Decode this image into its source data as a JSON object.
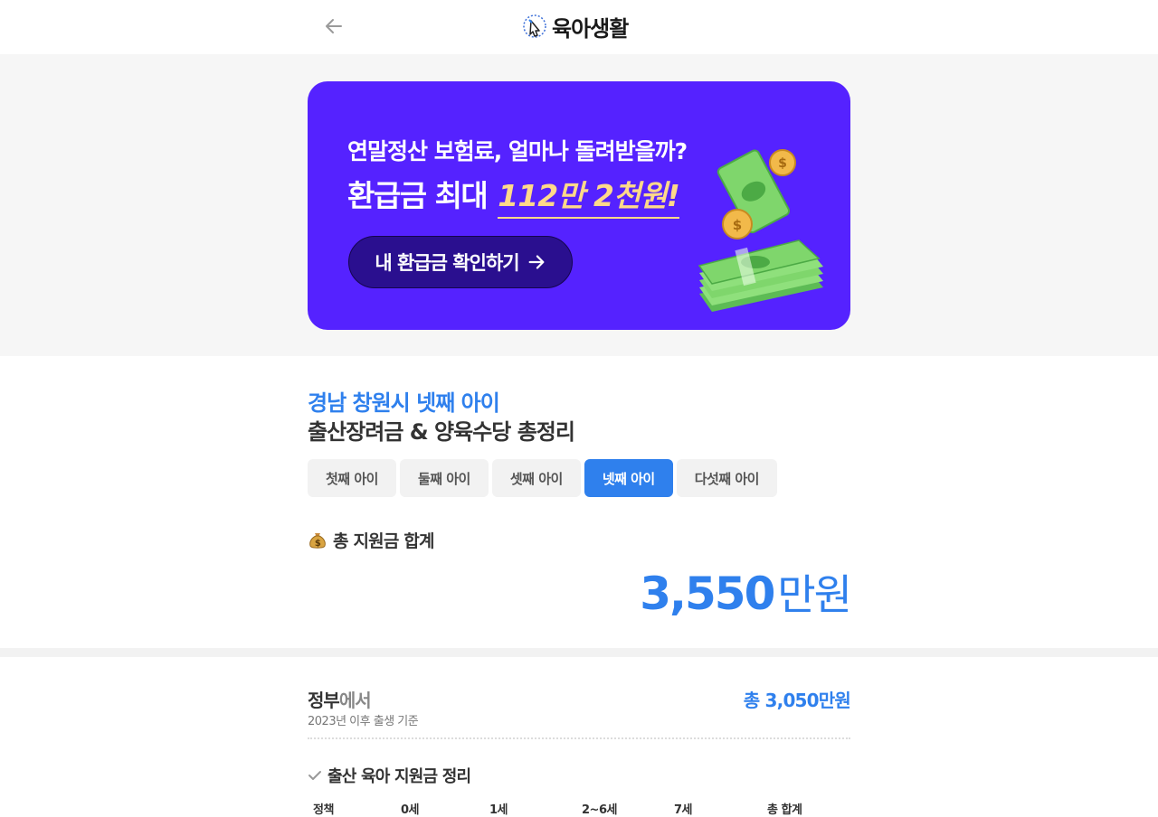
{
  "header": {
    "back_icon": "arrow-left-icon",
    "logo_icon": "hand-touch-icon",
    "logo_text": "육아생활"
  },
  "banner": {
    "line1": "연말정산 보험료, 얼마나 돌려받을까?",
    "line2_prefix": "환급금 최대",
    "line2_amount": "112만 2천원!",
    "cta_label": "내 환급금 확인하기",
    "cta_icon": "arrow-right-icon",
    "illustration": "money-stack-illustration",
    "colors": {
      "background": "#5522ff",
      "button": "#2a0f8f",
      "highlight": "#ffd98a"
    }
  },
  "summary": {
    "region_title": "경남 창원시 넷째 아이",
    "page_title": "출산장려금 & 양육수당 총정리",
    "tabs": [
      {
        "label": "첫째 아이",
        "active": false
      },
      {
        "label": "둘째 아이",
        "active": false
      },
      {
        "label": "셋째 아이",
        "active": false
      },
      {
        "label": "넷째 아이",
        "active": true
      },
      {
        "label": "다섯째 아이",
        "active": false
      }
    ],
    "total_label": "총 지원금 합계",
    "total_icon": "money-bag-icon",
    "total_number": "3,550",
    "total_unit": "만원",
    "accent_color": "#2f80ed"
  },
  "government": {
    "title_strong": "정부",
    "title_muted": "에서",
    "subtitle": "2023년 이후 출생 기준",
    "total": "총 3,050만원",
    "sub_heading": "출산 육아 지원금 정리",
    "sub_heading_icon": "check-icon",
    "table_headers": [
      "정책",
      "0세",
      "1세",
      "2~6세",
      "7세",
      "총 합계"
    ]
  }
}
